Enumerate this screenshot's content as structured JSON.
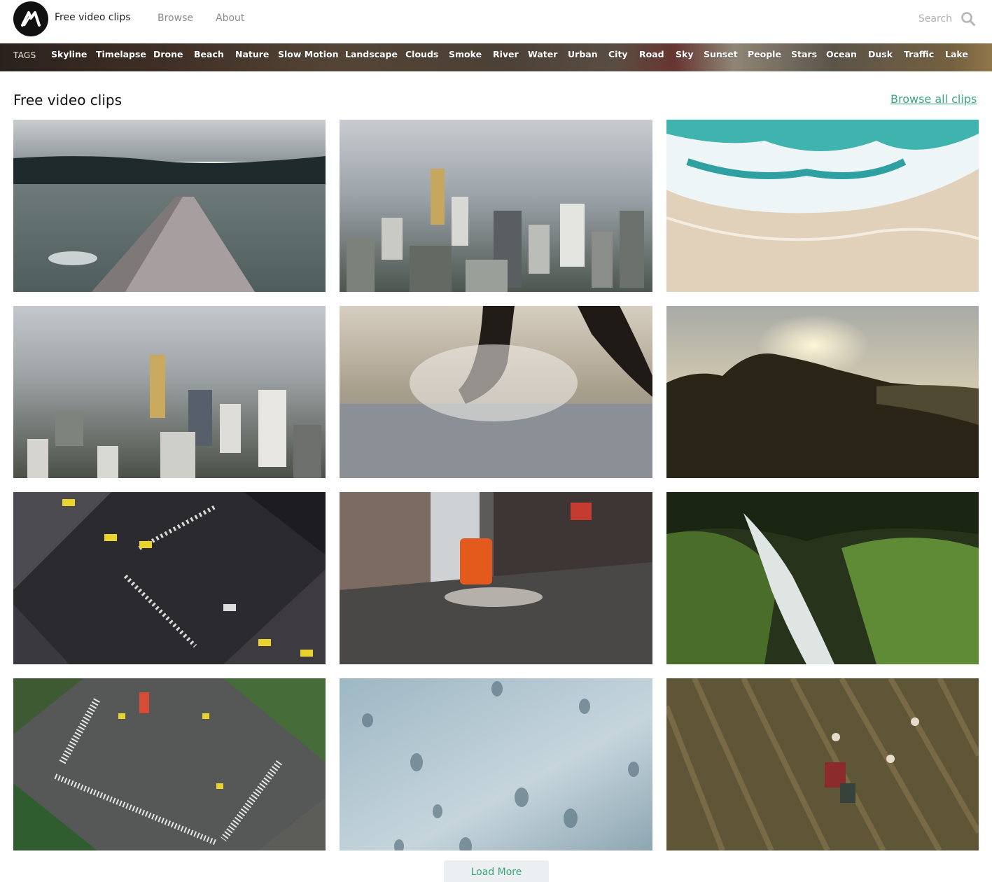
{
  "header": {
    "brand": "Free video clips",
    "nav": {
      "browse": "Browse",
      "about": "About"
    },
    "search_placeholder": "Search",
    "logo_icon": "m-logo-icon",
    "search_icon": "search-icon"
  },
  "tags": {
    "label": "TAGS",
    "items": [
      "Skyline",
      "Timelapse",
      "Drone",
      "Beach",
      "Nature",
      "Slow Motion",
      "Landscape",
      "Clouds",
      "Smoke",
      "River",
      "Water",
      "Urban",
      "City",
      "Road",
      "Sky",
      "Sunset",
      "People",
      "Stars",
      "Ocean",
      "Dusk",
      "Traffic",
      "Lake"
    ]
  },
  "main": {
    "title": "Free video clips",
    "browse_all": "Browse all clips",
    "load_more": "Load More"
  },
  "colors": {
    "accent": "#3aa57a",
    "load_more_bg": "#eceff1"
  }
}
